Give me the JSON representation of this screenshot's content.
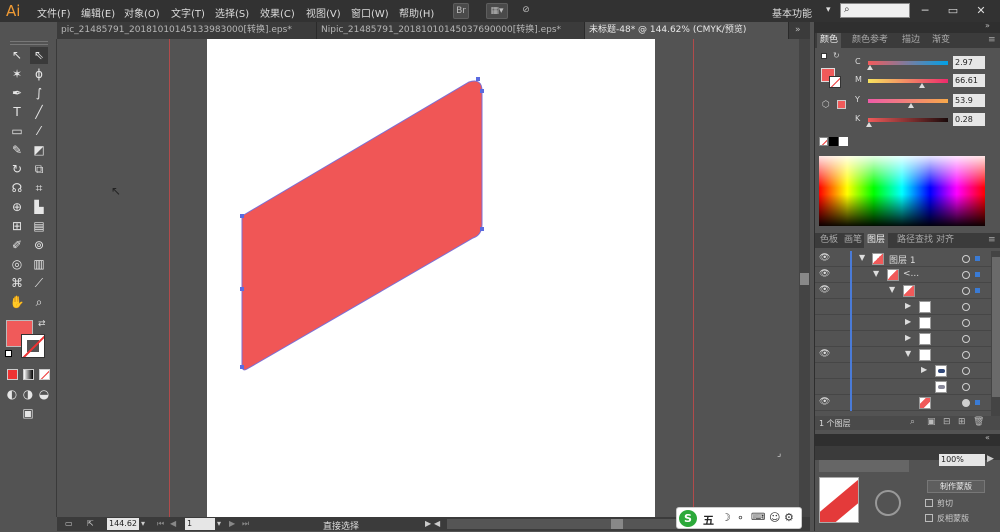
{
  "app": {
    "logo": "Ai"
  },
  "menu": [
    "文件(F)",
    "编辑(E)",
    "对象(O)",
    "文字(T)",
    "选择(S)",
    "效果(C)",
    "视图(V)",
    "窗口(W)",
    "帮助(H)"
  ],
  "toolbar_icons": {
    "br": "Br"
  },
  "workspace": "基本功能",
  "tabs": [
    "pic_21485791_20181010145133983000[转换].eps*",
    "Nipic_21485791_20181010145037690000[转换].eps*",
    "未标题-48* @ 144.62% (CMYK/预览)"
  ],
  "color_panel": {
    "tabs": [
      "颜色",
      "颜色参考",
      "描边",
      "渐变"
    ],
    "channels": [
      {
        "label": "C",
        "value": "2.97",
        "pos": 0.03
      },
      {
        "label": "M",
        "value": "66.61",
        "pos": 0.67
      },
      {
        "label": "Y",
        "value": "53.9",
        "pos": 0.54
      },
      {
        "label": "K",
        "value": "0.28",
        "pos": 0.01
      }
    ],
    "fill_color": "#f05a5a"
  },
  "layers_panel": {
    "tabs": [
      "色板",
      "画笔",
      "图层",
      "路径查找",
      "对齐"
    ],
    "layer_name": "图层 1",
    "group_name": "<...",
    "footer": "1 个图层"
  },
  "lower_panel": {
    "make_mask": "制作蒙版",
    "clip": "剪切",
    "invert_mask": "反相蒙版",
    "percent": "100%"
  },
  "status": {
    "zoom": "144.62",
    "page": "1",
    "tool": "直接选择"
  },
  "artwork": {
    "shape_color": "#f05656",
    "anchor_color": "#5a6be0"
  },
  "ime": {
    "lang": "五"
  }
}
